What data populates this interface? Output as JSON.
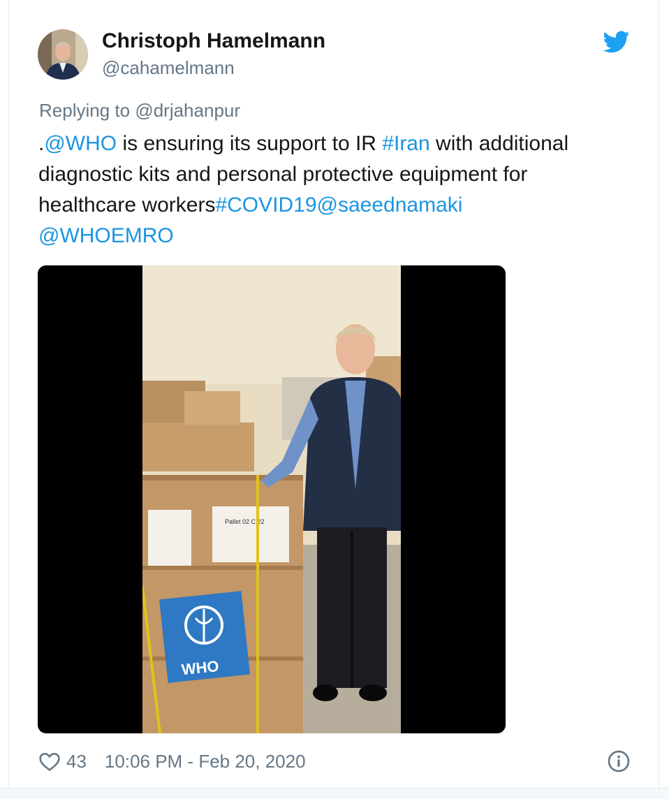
{
  "tweet": {
    "author": {
      "display_name": "Christoph Hamelmann",
      "handle": "@cahamelmann",
      "avatar_icon": "profile-photo"
    },
    "reply": {
      "prefix": "Replying to ",
      "to": "@drjahanpur"
    },
    "text_parts": {
      "p1": ".",
      "m1": "@WHO",
      "p2": " is ensuring its support to IR ",
      "h1": "#Iran",
      "p3": " with additional diagnostic kits and personal protective equipment for healthcare workers",
      "h2": "#COVID19",
      "m2": "@saeednamaki",
      "m3": "@WHOEMRO"
    },
    "media": {
      "box_label": "WHO",
      "pallet_label": "Pallet 02 C 22"
    },
    "footer": {
      "likes": "43",
      "timestamp": "10:06 PM - Feb 20, 2020",
      "heart_icon": "heart-icon",
      "info_icon": "info-icon"
    },
    "colors": {
      "link": "#1b95e0",
      "secondary": "#657786",
      "twitter_blue": "#1da1f2"
    }
  }
}
